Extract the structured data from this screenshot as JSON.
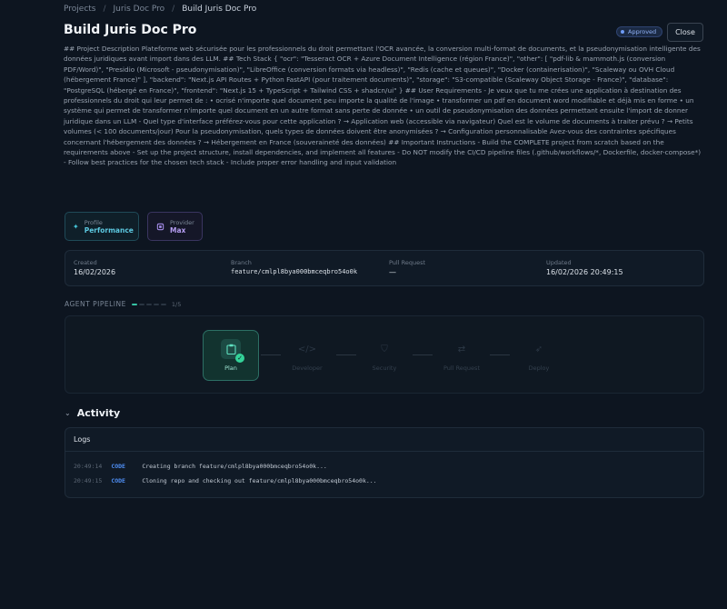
{
  "breadcrumb": [
    "Projects",
    "Juris Doc Pro",
    "Build Juris Doc Pro"
  ],
  "title": "Build Juris Doc Pro",
  "status_badge": "Approved",
  "close_label": "Close",
  "description": "## Project Description Plateforme web sécurisée pour les professionnels du droit permettant l'OCR avancée, la conversion multi-format de documents, et la pseudonymisation intelligente des données juridiques avant import dans des LLM. ## Tech Stack { \"ocr\": \"Tesseract OCR + Azure Document Intelligence (région France)\", \"other\": [ \"pdf-lib & mammoth.js (conversion PDF/Word)\", \"Presidio (Microsoft - pseudonymisation)\", \"LibreOffice (conversion formats via headless)\", \"Redis (cache et queues)\", \"Docker (containerisation)\", \"Scaleway ou OVH Cloud (hébergement France)\" ], \"backend\": \"Next.js API Routes + Python FastAPI (pour traitement documents)\", \"storage\": \"S3-compatible (Scaleway Object Storage - France)\", \"database\": \"PostgreSQL (hébergé en France)\", \"frontend\": \"Next.js 15 + TypeScript + Tailwind CSS + shadcn/ui\" } ## User Requirements - Je veux que tu me crées une application à destination des professionnels du droit qui leur permet de : • ocrisé n'importe quel document peu importe la qualité de l'image • transformer un pdf en document word modifiable et déjà mis en forme • un système qui permet de transformer n'importe quel document en un autre format sans perte de donnée • un outil de pseudonymisation des données permettant ensuite l'import de donner juridique dans un LLM - Quel type d'interface préférez-vous pour cette application ? → Application web (accessible via navigateur) Quel est le volume de documents à traiter prévu ? → Petits volumes (< 100 documents/jour) Pour la pseudonymisation, quels types de données doivent être anonymisées ? → Configuration personnalisable Avez-vous des contraintes spécifiques concernant l'hébergement des données ? → Hébergement en France (souveraineté des données) ## Important Instructions - Build the COMPLETE project from scratch based on the requirements above - Set up the project structure, install dependencies, and implement all features - Do NOT modify the CI/CD pipeline files (.github/workflows/*, Dockerfile, docker-compose*) - Follow best practices for the chosen tech stack - Include proper error handling and input validation",
  "profile": {
    "label": "Profile",
    "value": "Performance",
    "icon": "sparkle-icon"
  },
  "provider": {
    "label": "Provider",
    "value": "Max",
    "icon": "chip-icon"
  },
  "info": {
    "created_label": "Created",
    "created_value": "16/02/2026",
    "branch_label": "Branch",
    "branch_value": "feature/cmlpl8bya000bmceqbro54o0k",
    "pr_label": "Pull Request",
    "pr_value": "—",
    "updated_label": "Updated",
    "updated_value": "16/02/2026 20:49:15"
  },
  "pipeline": {
    "title": "AGENT PIPELINE",
    "progress_text": "1/5",
    "completed": 1,
    "total": 5,
    "stages": [
      {
        "name": "Plan",
        "icon": "clipboard-icon",
        "state": "active"
      },
      {
        "name": "Developer",
        "icon": "code-icon",
        "state": "pending"
      },
      {
        "name": "Security",
        "icon": "shield-icon",
        "state": "pending"
      },
      {
        "name": "Pull Request",
        "icon": "git-pull-icon",
        "state": "pending"
      },
      {
        "name": "Deploy",
        "icon": "rocket-icon",
        "state": "pending"
      }
    ]
  },
  "activity": {
    "title": "Activity",
    "logs_title": "Logs",
    "logs": [
      {
        "time": "20:49:14",
        "type": "CODE",
        "message": "Creating branch feature/cmlpl8bya000bmceqbro54o0k..."
      },
      {
        "time": "20:49:15",
        "type": "CODE",
        "message": "Cloning repo and checking out feature/cmlpl8bya000bmceqbro54o0k..."
      }
    ]
  }
}
